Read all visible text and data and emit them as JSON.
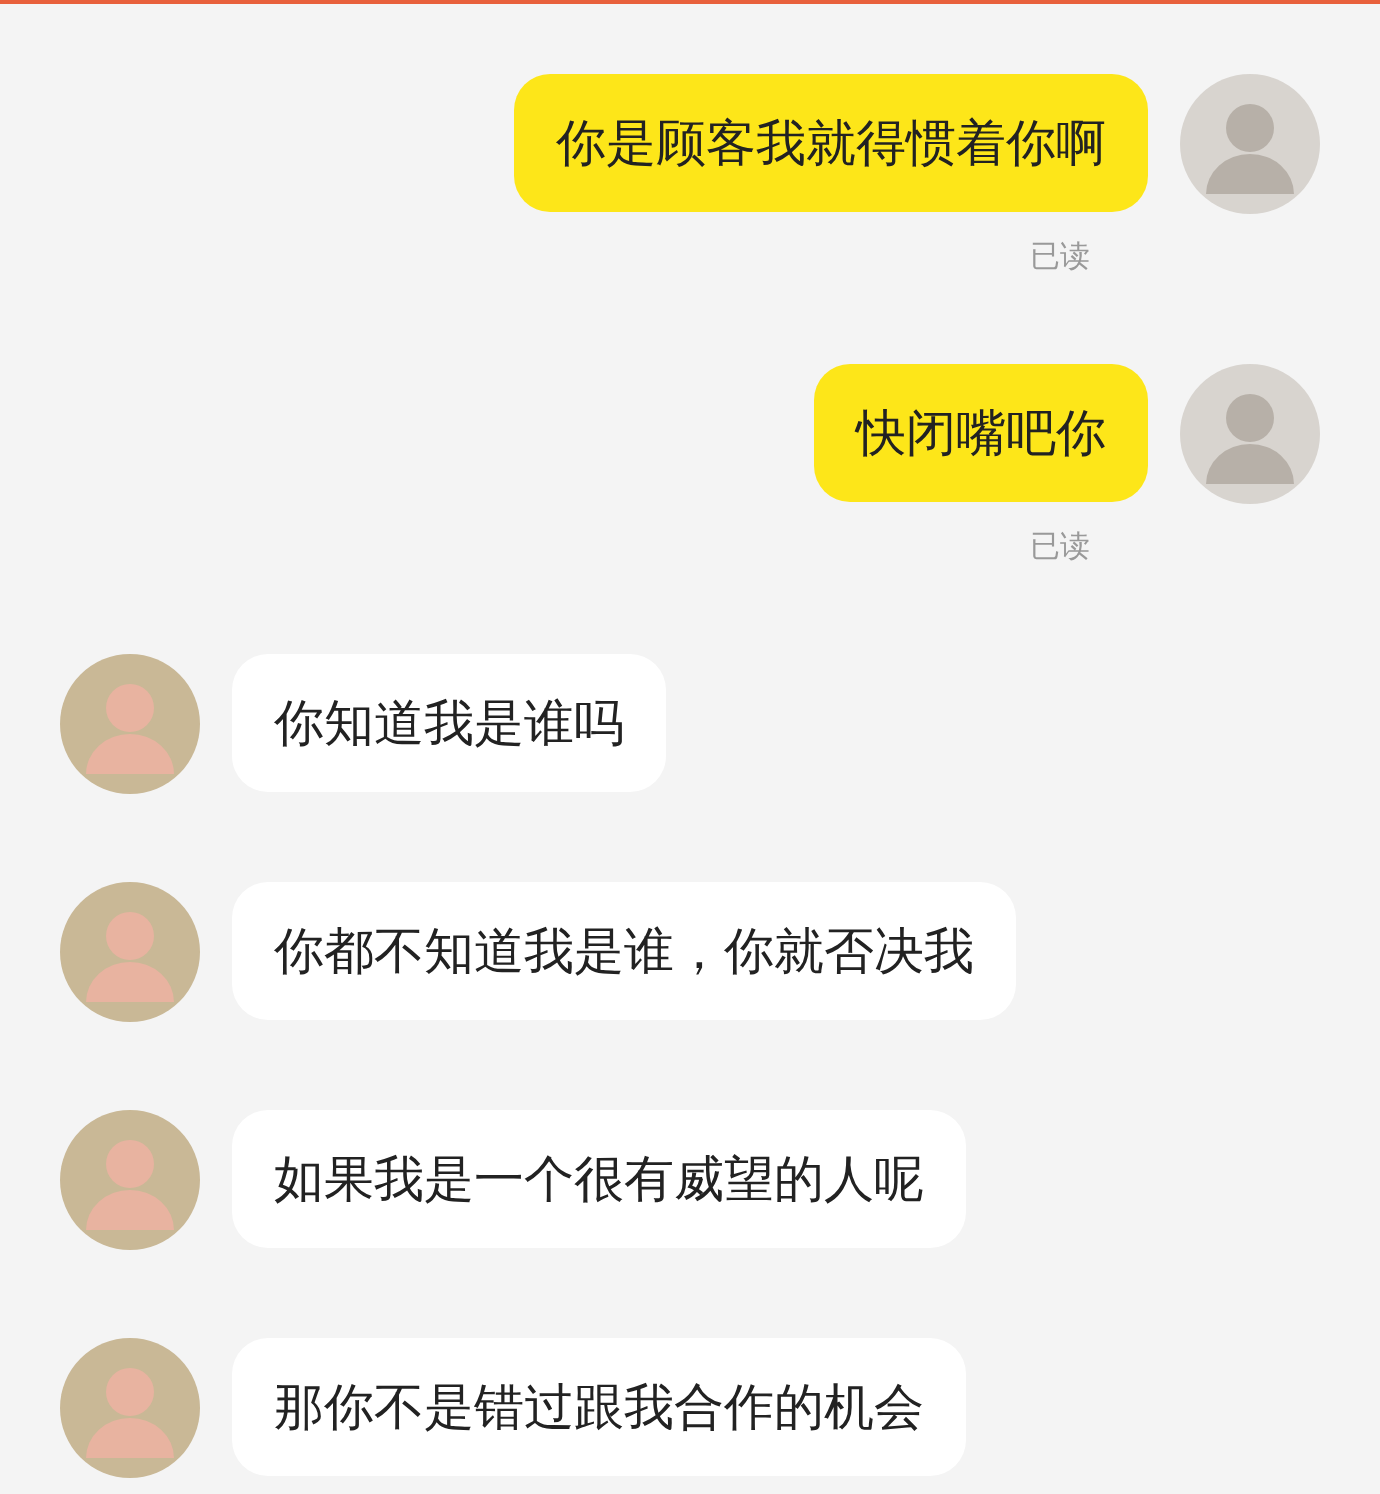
{
  "messages": [
    {
      "kind": "outgoing",
      "text": "你是顾客我就得惯着你啊",
      "status": "已读"
    },
    {
      "kind": "outgoing",
      "text": "快闭嘴吧你",
      "status": "已读"
    },
    {
      "kind": "incoming",
      "text": "你知道我是谁吗"
    },
    {
      "kind": "incoming",
      "text": "你都不知道我是谁，你就否决我"
    },
    {
      "kind": "incoming",
      "text": "如果我是一个很有威望的人呢"
    },
    {
      "kind": "incoming",
      "text": "那你不是错过跟我合作的机会"
    }
  ]
}
